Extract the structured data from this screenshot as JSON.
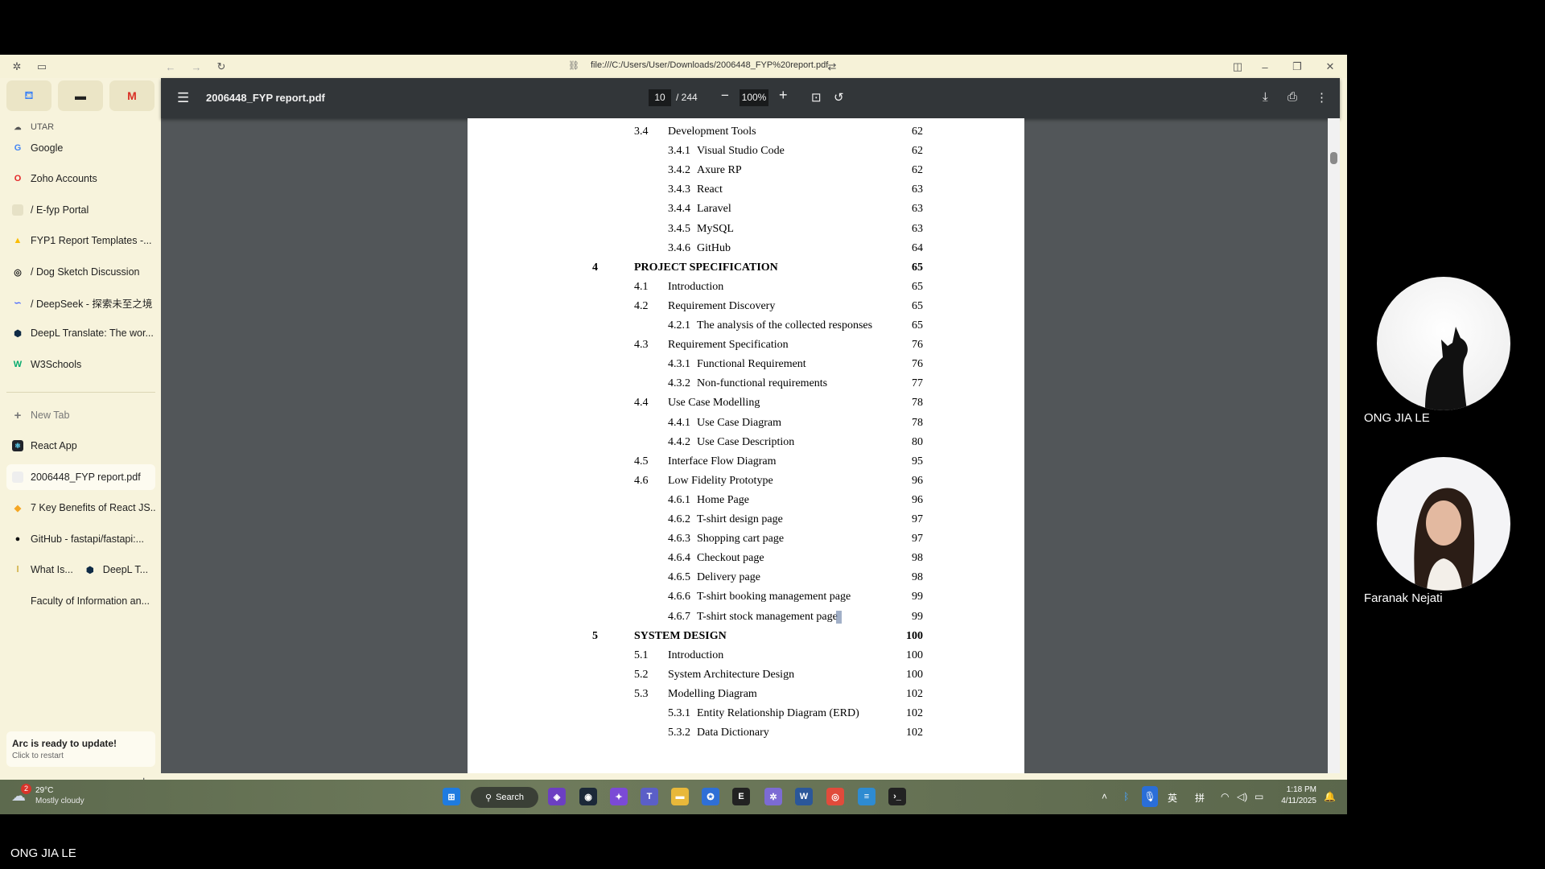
{
  "browser": {
    "url": "file:///C:/Users/User/Downloads/2006448_FYP%20report.pdf"
  },
  "sidebar": {
    "folder_label": "UTAR",
    "items": [
      {
        "label": "Google",
        "icon": "google-icon",
        "color": "#4285f4"
      },
      {
        "label": "Zoho Accounts",
        "icon": "zoho-icon",
        "color": "#e42527"
      },
      {
        "label": "/  E-fyp Portal",
        "icon": "page-icon",
        "color": "#cccccc"
      },
      {
        "label": "FYP1 Report Templates -...",
        "icon": "google-drive-icon",
        "color": "#fbbc04"
      },
      {
        "label": "/  Dog Sketch Discussion",
        "icon": "chatgpt-icon",
        "color": "#222222"
      },
      {
        "label": "/  DeepSeek - 探索未至之境",
        "icon": "deepseek-icon",
        "color": "#4d6bfe"
      },
      {
        "label": "DeepL Translate: The wor...",
        "icon": "deepl-icon",
        "color": "#0f2b46"
      },
      {
        "label": "W3Schools",
        "icon": "w3schools-icon",
        "color": "#04aa6d"
      }
    ],
    "new_tab": "New Tab",
    "tabs": [
      {
        "label": "React App",
        "icon": "react-icon",
        "color": "#20232a"
      },
      {
        "label": "2006448_FYP report.pdf",
        "icon": "pdf-icon",
        "color": "#dddddd"
      },
      {
        "label": "7 Key Benefits of React JS...",
        "icon": "article-icon",
        "color": "#f5a623"
      },
      {
        "label": "GitHub - fastapi/fastapi:...",
        "icon": "github-icon",
        "color": "#111111"
      }
    ],
    "split_tab": {
      "left": "What Is...",
      "right": "DeepL T..."
    },
    "last_tab": "Faculty of Information an...",
    "update_title": "Arc is ready to update!",
    "update_sub": "Click to restart"
  },
  "pdf": {
    "title": "2006448_FYP report.pdf",
    "page_current": "10",
    "page_total": "/ 244",
    "zoom": "100%",
    "toc": [
      {
        "num": "3.4",
        "title": "Development Tools",
        "page": "62",
        "level": 2
      },
      {
        "num": "3.4.1",
        "title": "Visual Studio Code",
        "page": "62",
        "level": 3
      },
      {
        "num": "3.4.2",
        "title": "Axure RP",
        "page": "62",
        "level": 3
      },
      {
        "num": "3.4.3",
        "title": "React",
        "page": "63",
        "level": 3
      },
      {
        "num": "3.4.4",
        "title": "Laravel",
        "page": "63",
        "level": 3
      },
      {
        "num": "3.4.5",
        "title": "MySQL",
        "page": "63",
        "level": 3
      },
      {
        "num": "3.4.6",
        "title": "GitHub",
        "page": "64",
        "level": 3
      },
      {
        "num": "4",
        "title": "PROJECT SPECIFICATION",
        "page": "65",
        "level": 1
      },
      {
        "num": "4.1",
        "title": "Introduction",
        "page": "65",
        "level": 2
      },
      {
        "num": "4.2",
        "title": "Requirement Discovery",
        "page": "65",
        "level": 2
      },
      {
        "num": "4.2.1",
        "title": "The analysis of the collected responses",
        "page": "65",
        "level": 3
      },
      {
        "num": "4.3",
        "title": "Requirement Specification",
        "page": "76",
        "level": 2
      },
      {
        "num": "4.3.1",
        "title": "Functional Requirement",
        "page": "76",
        "level": 3
      },
      {
        "num": "4.3.2",
        "title": "Non-functional requirements",
        "page": "77",
        "level": 3
      },
      {
        "num": "4.4",
        "title": "Use Case Modelling",
        "page": "78",
        "level": 2
      },
      {
        "num": "4.4.1",
        "title": "Use Case Diagram",
        "page": "78",
        "level": 3
      },
      {
        "num": "4.4.2",
        "title": "Use Case Description",
        "page": "80",
        "level": 3
      },
      {
        "num": "4.5",
        "title": "Interface Flow Diagram",
        "page": "95",
        "level": 2
      },
      {
        "num": "4.6",
        "title": "Low Fidelity Prototype",
        "page": "96",
        "level": 2
      },
      {
        "num": "4.6.1",
        "title": "Home Page",
        "page": "96",
        "level": 3
      },
      {
        "num": "4.6.2",
        "title": "T-shirt design page",
        "page": "97",
        "level": 3
      },
      {
        "num": "4.6.3",
        "title": "Shopping cart page",
        "page": "97",
        "level": 3
      },
      {
        "num": "4.6.4",
        "title": "Checkout page",
        "page": "98",
        "level": 3
      },
      {
        "num": "4.6.5",
        "title": "Delivery page",
        "page": "98",
        "level": 3
      },
      {
        "num": "4.6.6",
        "title": "T-shirt booking management page",
        "page": "99",
        "level": 3
      },
      {
        "num": "4.6.7",
        "title": "T-shirt stock management page",
        "page": "99",
        "level": 3
      },
      {
        "num": "5",
        "title": "SYSTEM DESIGN",
        "page": "100",
        "level": 1
      },
      {
        "num": "5.1",
        "title": "Introduction",
        "page": "100",
        "level": 2
      },
      {
        "num": "5.2",
        "title": "System Architecture Design",
        "page": "100",
        "level": 2
      },
      {
        "num": "5.3",
        "title": "Modelling Diagram",
        "page": "102",
        "level": 2
      },
      {
        "num": "5.3.1",
        "title": "Entity Relationship Diagram (ERD)",
        "page": "102",
        "level": 3
      },
      {
        "num": "5.3.2",
        "title": "Data Dictionary",
        "page": "102",
        "level": 3
      }
    ]
  },
  "taskbar": {
    "weather_temp": "29°C",
    "weather_desc": "Mostly cloudy",
    "search_label": "Search",
    "ime_lang": "英",
    "ime_mode": "拼",
    "time": "1:18 PM",
    "date": "4/11/2025",
    "weather_badge": "2"
  },
  "participants": [
    {
      "name": "ONG JIA LE"
    },
    {
      "name": "Faranak Nejati"
    }
  ],
  "presenter_name": "ONG JIA LE"
}
